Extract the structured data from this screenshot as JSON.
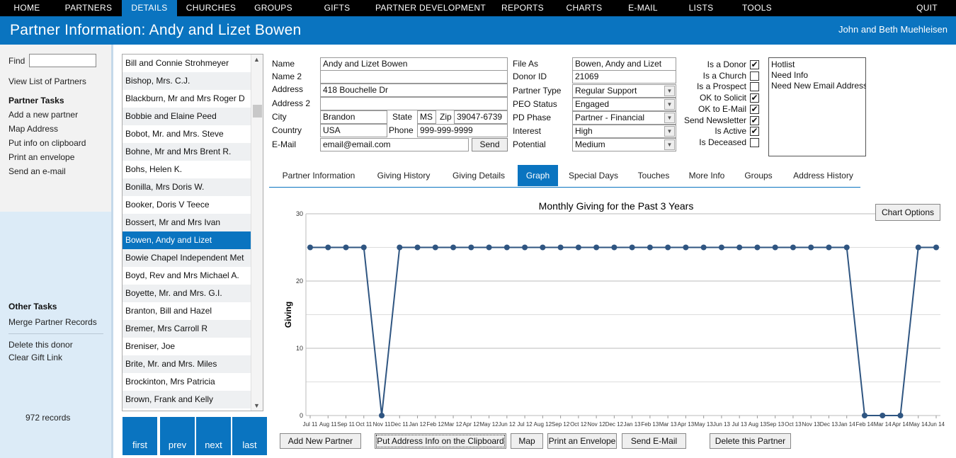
{
  "nav": {
    "items": [
      "HOME",
      "PARTNERS",
      "DETAILS",
      "CHURCHES",
      "GROUPS",
      "GIFTS",
      "PARTNER DEVELOPMENT",
      "REPORTS",
      "CHARTS",
      "E-MAIL",
      "LISTS",
      "TOOLS",
      "QUIT"
    ],
    "active": "DETAILS"
  },
  "header": {
    "title": "Partner Information: Andy and Lizet Bowen",
    "user": "John and Beth Muehleisen"
  },
  "sidebar": {
    "find_label": "Find",
    "find_value": "",
    "view_list": "View List of Partners",
    "partner_tasks_heading": "Partner Tasks",
    "partner_tasks": [
      "Add a new partner",
      "Map Address",
      "Put info on clipboard",
      "Print an envelope",
      "Send an e-mail"
    ],
    "other_tasks_heading": "Other Tasks",
    "merge": "Merge Partner Records",
    "delete_donor": "Delete this donor",
    "clear_gift": "Clear Gift Link",
    "record_count": "972 records"
  },
  "partner_list": {
    "items": [
      "Bill and Connie Strohmeyer",
      "Bishop, Mrs. C.J.",
      "Blackburn, Mr and Mrs Roger D",
      "Bobbie and Elaine Peed",
      "Bobot, Mr. and Mrs. Steve",
      "Bohne, Mr and Mrs Brent R.",
      "Bohs, Helen K.",
      "Bonilla, Mrs Doris W.",
      "Booker, Doris V Teece",
      "Bossert, Mr and Mrs Ivan",
      "Bowen, Andy and Lizet",
      "Bowie Chapel Independent Met",
      "Boyd, Rev and Mrs Michael A.",
      "Boyette, Mr. and Mrs. G.I.",
      "Branton, Bill and Hazel",
      "Bremer, Mrs Carroll R",
      "Breniser, Joe",
      "Brite, Mr. and Mrs. Miles",
      "Brockinton, Mrs Patricia",
      "Brown, Frank and Kelly"
    ],
    "selected": "Bowen, Andy and Lizet",
    "buttons": [
      "first",
      "prev",
      "next",
      "last"
    ]
  },
  "form": {
    "labels": {
      "name": "Name",
      "name2": "Name 2",
      "address": "Address",
      "address2": "Address 2",
      "city": "City",
      "state": "State",
      "zip": "Zip",
      "country": "Country",
      "phone": "Phone",
      "email": "E-Mail",
      "file_as": "File As",
      "donor_id": "Donor ID",
      "partner_type": "Partner Type",
      "peo_status": "PEO Status",
      "pd_phase": "PD Phase",
      "interest": "Interest",
      "potential": "Potential"
    },
    "values": {
      "name": "Andy and Lizet Bowen",
      "name2": "",
      "address": "418 Bouchelle Dr",
      "address2": "",
      "city": "Brandon",
      "state": "MS",
      "zip": "39047-6739",
      "country": "USA",
      "phone": "999-999-9999",
      "email": "email@email.com",
      "file_as": "Bowen, Andy and Lizet",
      "donor_id": "21069",
      "partner_type": "Regular Support",
      "peo_status": "Engaged",
      "pd_phase": "Partner - Financial",
      "interest": "High",
      "potential": "Medium"
    },
    "send_label": "Send"
  },
  "checkboxes": [
    {
      "label": "Is a Donor",
      "checked": true
    },
    {
      "label": "Is a Church",
      "checked": false
    },
    {
      "label": "Is a Prospect",
      "checked": false
    },
    {
      "label": "OK to Solicit",
      "checked": true
    },
    {
      "label": "OK to E-Mail",
      "checked": true
    },
    {
      "label": "Send Newsletter",
      "checked": true
    },
    {
      "label": "Is Active",
      "checked": true
    },
    {
      "label": "Is Deceased",
      "checked": false
    }
  ],
  "flags": [
    "Hotlist",
    "Need Info",
    "Need New Email Address"
  ],
  "tabs": {
    "items": [
      "Partner Information",
      "Giving History",
      "Giving Details",
      "Graph",
      "Special Days",
      "Touches",
      "More Info",
      "Groups",
      "Address History"
    ],
    "active": "Graph"
  },
  "chart_options_label": "Chart Options",
  "chart_data": {
    "type": "line",
    "title": "Monthly Giving for the Past 3 Years",
    "xlabel": "",
    "ylabel": "Giving",
    "ylim": [
      0,
      30
    ],
    "yticks": [
      0,
      10,
      20,
      30
    ],
    "grid": true,
    "categories": [
      "Jul 11",
      "Aug 11",
      "Sep 11",
      "Oct 11",
      "Nov 11",
      "Dec 11",
      "Jan 12",
      "Feb 12",
      "Mar 12",
      "Apr 12",
      "May 12",
      "Jun 12",
      "Jul 12",
      "Aug 12",
      "Sep 12",
      "Oct 12",
      "Nov 12",
      "Dec 12",
      "Jan 13",
      "Feb 13",
      "Mar 13",
      "Apr 13",
      "May 13",
      "Jun 13",
      "Jul 13",
      "Aug 13",
      "Sep 13",
      "Oct 13",
      "Nov 13",
      "Dec 13",
      "Jan 14",
      "Feb 14",
      "Mar 14",
      "Apr 14",
      "May 14",
      "Jun 14"
    ],
    "values": [
      25,
      25,
      25,
      25,
      0,
      25,
      25,
      25,
      25,
      25,
      25,
      25,
      25,
      25,
      25,
      25,
      25,
      25,
      25,
      25,
      25,
      25,
      25,
      25,
      25,
      25,
      25,
      25,
      25,
      25,
      25,
      0,
      0,
      0,
      25,
      25
    ],
    "color": "#2f5581"
  },
  "bottom_buttons": [
    "Add New Partner",
    "Put Address Info on the Clipboard",
    "Map",
    "Print an Envelope",
    "Send E-Mail",
    "Delete this Partner"
  ],
  "colors": {
    "accent": "#0a74c0",
    "nav_bg": "#000000",
    "line": "#2f5581"
  }
}
